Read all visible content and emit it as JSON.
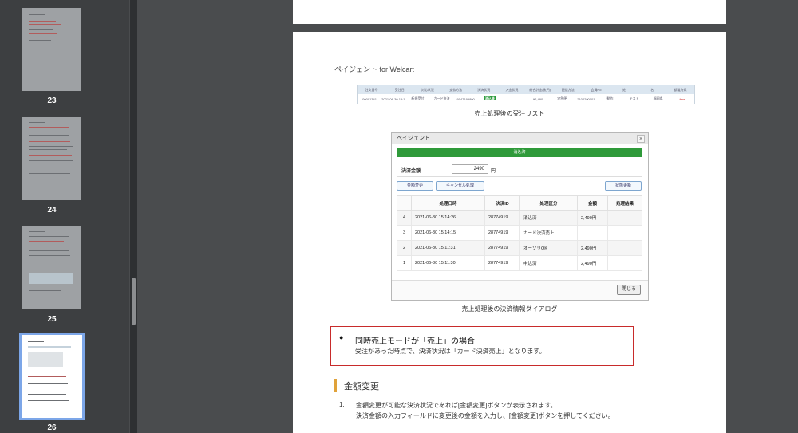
{
  "sidebar": {
    "thumbnails": [
      {
        "page": "23"
      },
      {
        "page": "24"
      },
      {
        "page": "25"
      },
      {
        "page": "26",
        "selected": true
      }
    ]
  },
  "page": {
    "header": "ペイジェント for Welcart",
    "order_list": {
      "headers": [
        "注文番号",
        "受注日",
        "対応状況",
        "支払方法",
        "決済状況",
        "入金状況",
        "総合計金額(円)",
        "配送方法",
        "会員No",
        "姓",
        "名",
        "都道府県"
      ],
      "row": [
        "00001341",
        "2021-06-30 15:11",
        "新規受付",
        "カード決済",
        "9147199800",
        "消込済",
        "",
        "¥2,490",
        "宅急便",
        "2104290001",
        "動作",
        "テスト",
        "福岡県",
        "free"
      ]
    },
    "caption1": "売上処理後の受注リスト",
    "dialog": {
      "title": "ペイジェント",
      "close_x": "×",
      "status": "消込済",
      "amount_label": "決済金額",
      "amount_value": "2490",
      "amount_unit": "円",
      "btn_change": "金額変更",
      "btn_cancel": "キャンセル処理",
      "btn_refresh": "状態更新",
      "table_headers": [
        "",
        "処理日時",
        "決済ID",
        "処理区分",
        "金額",
        "処理結果"
      ],
      "rows": [
        [
          "4",
          "2021-06-30 15:14:26",
          "28774919",
          "消込済",
          "2,490円",
          ""
        ],
        [
          "3",
          "2021-06-30 15:14:15",
          "28774919",
          "カード決済売上",
          "",
          ""
        ],
        [
          "2",
          "2021-06-30 15:11:31",
          "28774919",
          "オーソリOK",
          "2,490円",
          ""
        ],
        [
          "1",
          "2021-06-30 15:11:30",
          "28774919",
          "申込済",
          "2,490円",
          ""
        ]
      ],
      "btn_close": "閉じる"
    },
    "caption2": "売上処理後の決済情報ダイアログ",
    "note": {
      "bullet": "●",
      "title": "同時売上モードが「売上」の場合",
      "body": "受注があった時点で、決済状況は「カード決済売上」となります。"
    },
    "section_title": "金額変更",
    "list": {
      "num": "1.",
      "line1": "金額変更が可能な決済状況であれば[金額変更]ボタンが表示されます。",
      "line2": "決済金額の入力フィールドに変更後の金額を入力し、[金額変更]ボタンを押してください。"
    }
  }
}
